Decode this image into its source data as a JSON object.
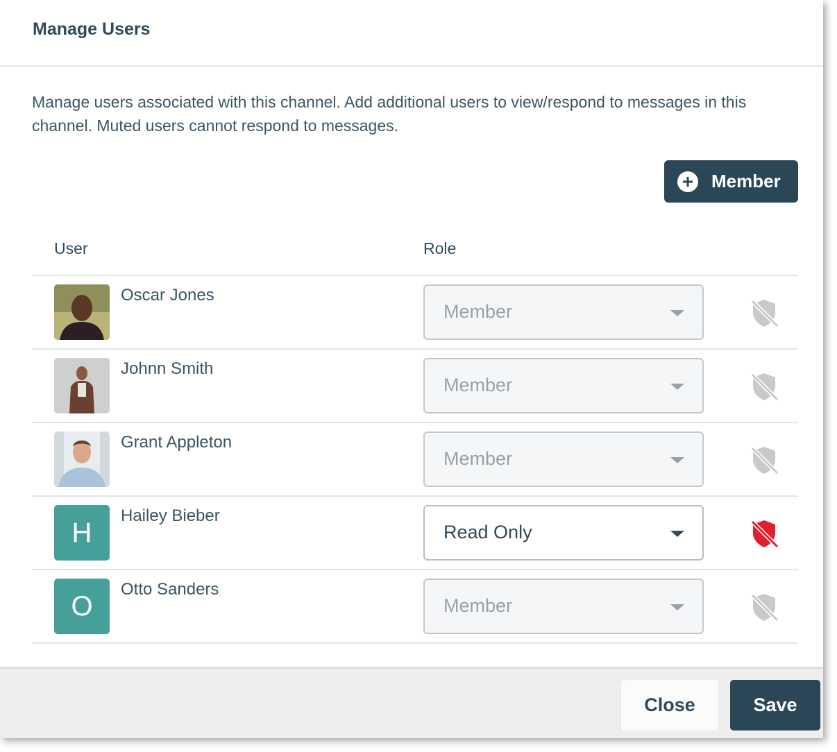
{
  "dialog": {
    "title": "Manage Users",
    "description": "Manage users associated with this channel. Add additional users to view/respond to messages in this channel. Muted users cannot respond to messages."
  },
  "add_member": {
    "label": "Member",
    "icon": "plus-circle-icon"
  },
  "table": {
    "headers": {
      "user": "User",
      "role": "Role"
    },
    "rows": [
      {
        "name": "Oscar Jones",
        "avatar": {
          "type": "photo",
          "initial": ""
        },
        "role": "Member",
        "muted": false
      },
      {
        "name": "Johnn Smith",
        "avatar": {
          "type": "photo",
          "initial": ""
        },
        "role": "Member",
        "muted": false
      },
      {
        "name": "Grant Appleton",
        "avatar": {
          "type": "photo",
          "initial": ""
        },
        "role": "Member",
        "muted": false
      },
      {
        "name": "Hailey Bieber",
        "avatar": {
          "type": "letter",
          "initial": "H"
        },
        "role": "Read Only",
        "muted": true
      },
      {
        "name": "Otto Sanders",
        "avatar": {
          "type": "letter",
          "initial": "O"
        },
        "role": "Member",
        "muted": false
      }
    ]
  },
  "footer": {
    "close_label": "Close",
    "save_label": "Save"
  },
  "colors": {
    "primary": "#2b4656",
    "avatar_letter_bg": "#46a09a",
    "mute_active": "#e0202e",
    "mute_inactive": "#c7c9cb"
  }
}
